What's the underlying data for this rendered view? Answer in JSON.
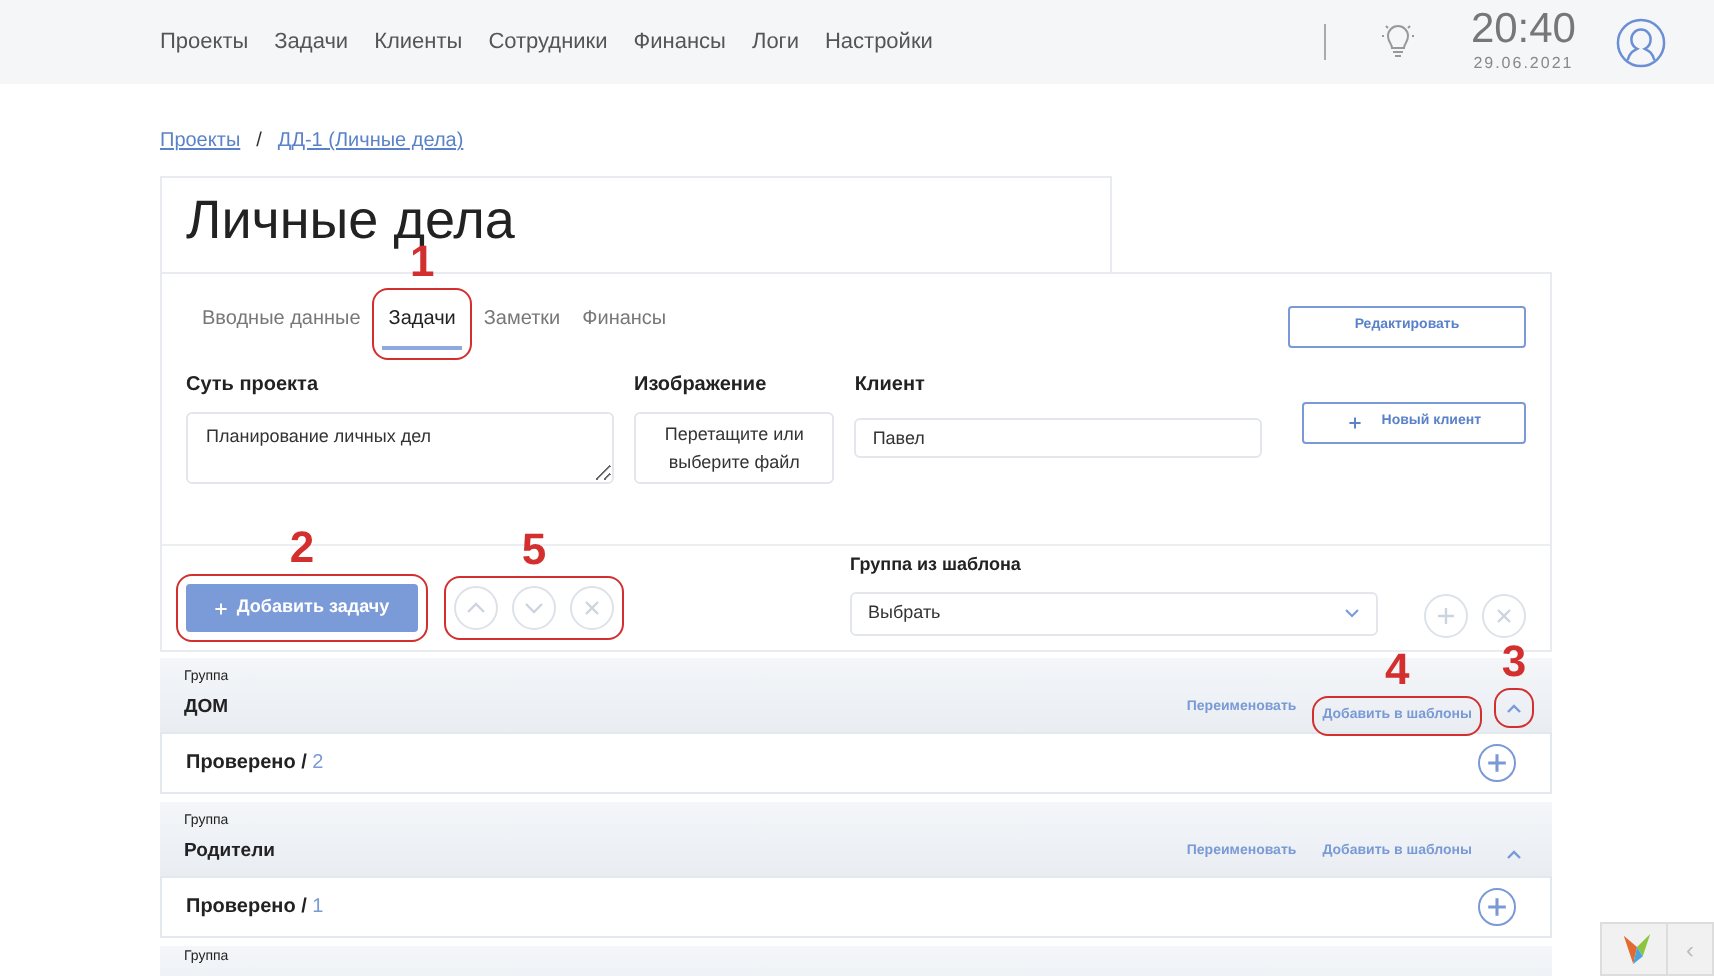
{
  "nav": {
    "items": [
      {
        "label": "Проекты"
      },
      {
        "label": "Задачи"
      },
      {
        "label": "Клиенты"
      },
      {
        "label": "Сотрудники"
      },
      {
        "label": "Финансы"
      },
      {
        "label": "Логи"
      },
      {
        "label": "Настройки"
      }
    ]
  },
  "clock": {
    "time": "20:40",
    "date": "29.06.2021"
  },
  "breadcrumb": {
    "items": [
      {
        "label": "Проекты"
      },
      {
        "label": "ДД-1 (Личные дела)"
      }
    ],
    "separator": "/"
  },
  "title": "Личные дела",
  "tabs": [
    {
      "label": "Вводные данные",
      "selected": false
    },
    {
      "label": "Задачи",
      "selected": true,
      "callout": "1"
    },
    {
      "label": "Заметки",
      "selected": false
    },
    {
      "label": "Финансы",
      "selected": false
    }
  ],
  "edit_button": "Редактировать",
  "fields": {
    "summary": {
      "label": "Суть проекта",
      "value": "Планирование личных дел"
    },
    "image": {
      "label": "Изображение",
      "text": "Перетащите или выберите файл"
    },
    "client": {
      "label": "Клиент",
      "value": "Павел"
    }
  },
  "new_client_button": "Новый клиент",
  "add_task_button": {
    "label": "Добавить задачу",
    "callout": "2"
  },
  "move_controls": {
    "callout": "5"
  },
  "template": {
    "label": "Группа из шаблона",
    "value": "Выбрать"
  },
  "groups": [
    {
      "caption": "Группа",
      "name": "ДОМ",
      "rename": "Переименовать",
      "add_template": "Добавить в шаблоны",
      "add_template_callout": "4",
      "collapse_callout": "3",
      "expanded": true,
      "sections": [
        {
          "label": "Проверено",
          "separator": "/",
          "count": "2"
        }
      ]
    },
    {
      "caption": "Группа",
      "name": "Родители",
      "rename": "Переименовать",
      "add_template": "Добавить в шаблоны",
      "expanded": true,
      "sections": [
        {
          "label": "Проверено",
          "separator": "/",
          "count": "1"
        }
      ]
    },
    {
      "caption": "Группа"
    }
  ],
  "debug_toolbar": {
    "toggle": "‹"
  }
}
